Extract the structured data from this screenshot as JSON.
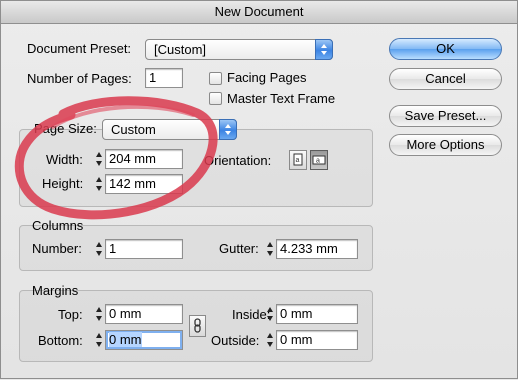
{
  "window": {
    "title": "New Document"
  },
  "document": {
    "preset_label": "Document Preset:",
    "preset_value": "[Custom]",
    "pages_label": "Number of Pages:",
    "pages_value": "1",
    "facing_pages_label": "Facing Pages",
    "master_text_frame_label": "Master Text Frame"
  },
  "page_size": {
    "label": "Page Size:",
    "value": "Custom",
    "width_label": "Width:",
    "width_value": "204 mm",
    "height_label": "Height:",
    "height_value": "142 mm",
    "orientation_label": "Orientation:",
    "orientation_selected": "landscape"
  },
  "columns": {
    "title": "Columns",
    "number_label": "Number:",
    "number_value": "1",
    "gutter_label": "Gutter:",
    "gutter_value": "4.233 mm"
  },
  "margins": {
    "title": "Margins",
    "top_label": "Top:",
    "top_value": "0 mm",
    "bottom_label": "Bottom:",
    "bottom_value": "0 mm",
    "inside_label": "Inside:",
    "inside_value": "0 mm",
    "outside_label": "Outside:",
    "outside_value": "0 mm"
  },
  "buttons": {
    "ok": "OK",
    "cancel": "Cancel",
    "save_preset": "Save Preset...",
    "more_options": "More Options"
  },
  "icons": {
    "spinner": "stepper-arrows-icon",
    "portrait": "portrait-orientation-icon",
    "landscape": "landscape-orientation-icon",
    "link": "chain-link-icon"
  },
  "colors": {
    "accent_blue": "#3c84e3",
    "annotation_red": "#d93a4e",
    "selection": "#b5d5ff"
  }
}
